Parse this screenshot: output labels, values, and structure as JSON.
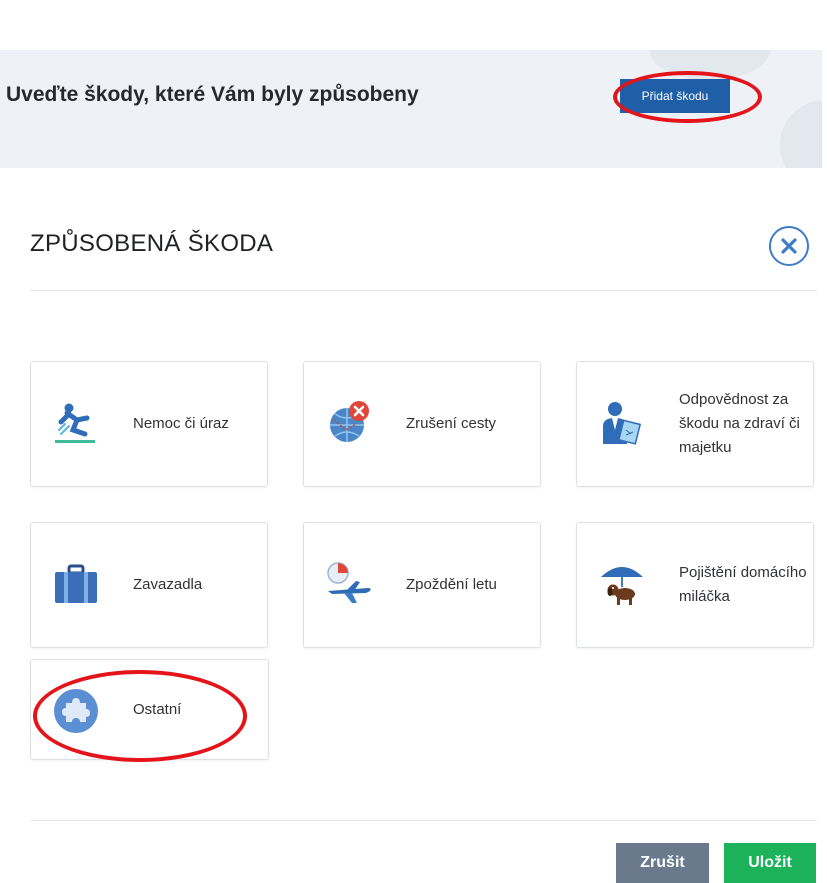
{
  "banner": {
    "title": "Uveďte škody, které Vám byly způsobeny",
    "add_button": "Přidat škodu"
  },
  "modal": {
    "title": "ZPŮSOBENÁ ŠKODA",
    "close_icon": "close-circle-icon"
  },
  "categories": [
    {
      "label": "Nemoc či úraz",
      "icon": "injury-fall-icon"
    },
    {
      "label": "Zrušení cesty",
      "icon": "globe-cancel-icon"
    },
    {
      "label": "Odpovědnost za škodu na zdraví či majetku",
      "icon": "liability-person-icon"
    },
    {
      "label": "Zavazadla",
      "icon": "suitcase-icon"
    },
    {
      "label": "Zpoždění letu",
      "icon": "plane-delay-icon"
    },
    {
      "label": "Pojištění domácího miláčka",
      "icon": "pet-umbrella-icon"
    },
    {
      "label": "Ostatní",
      "icon": "puzzle-icon"
    }
  ],
  "footer": {
    "cancel": "Zrušit",
    "save": "Uložit"
  },
  "colors": {
    "primary": "#1f5fa8",
    "save": "#1bb25a",
    "cancel": "#6a7a8c",
    "highlight": "#e3141a"
  }
}
